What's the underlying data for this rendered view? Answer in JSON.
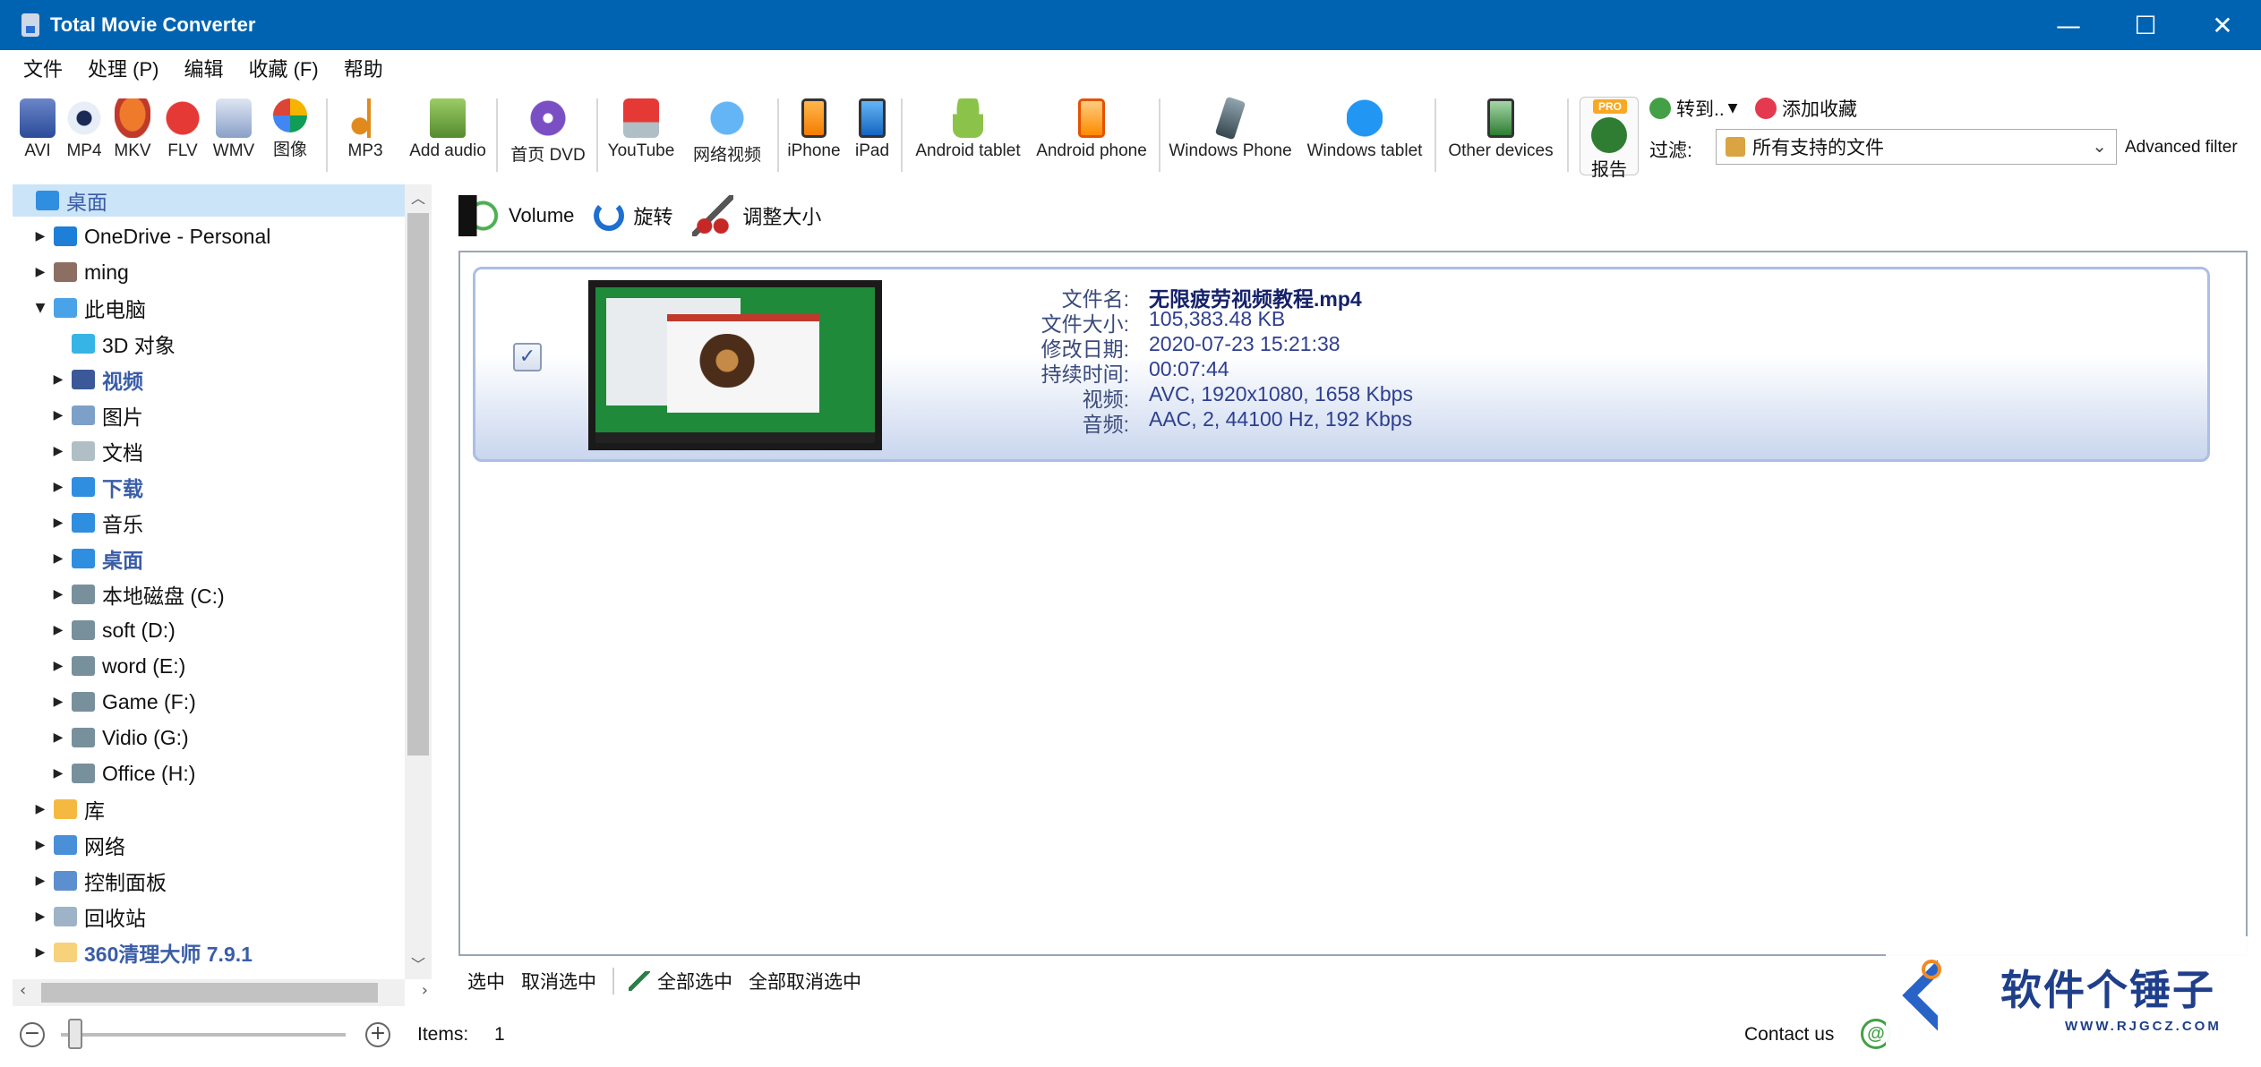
{
  "window": {
    "title": "Total Movie Converter"
  },
  "menu": [
    "文件",
    "处理 (P)",
    "编辑",
    "收藏 (F)",
    "帮助"
  ],
  "toolbar": {
    "formats": [
      "AVI",
      "MP4",
      "MKV",
      "FLV",
      "WMV",
      "图像"
    ],
    "audio": [
      "MP3",
      "Add audio"
    ],
    "disc": "首页 DVD",
    "web": [
      "YouTube",
      "网络视频"
    ],
    "apple": [
      "iPhone",
      "iPad"
    ],
    "android": [
      "Android tablet",
      "Android phone"
    ],
    "windows": [
      "Windows Phone",
      "Windows tablet"
    ],
    "other": "Other devices",
    "report": {
      "badge": "PRO",
      "label": "报告"
    },
    "goto": "转到..",
    "add_favorite": "添加收藏",
    "filter_label": "过滤:",
    "filter_value": "所有支持的文件",
    "advanced_filter": "Advanced filter"
  },
  "tree": [
    {
      "label": "桌面",
      "level": 0,
      "style": "selected-blue",
      "icon": "desktop-icon",
      "arrow": ""
    },
    {
      "label": "OneDrive - Personal",
      "level": 1,
      "icon": "cloud-icon",
      "arrow": "right"
    },
    {
      "label": "ming",
      "level": 1,
      "icon": "user-icon",
      "arrow": "right"
    },
    {
      "label": "此电脑",
      "level": 1,
      "icon": "computer-icon",
      "arrow": "down"
    },
    {
      "label": "3D 对象",
      "level": 2,
      "icon": "cube-icon",
      "arrow": ""
    },
    {
      "label": "视频",
      "level": 2,
      "style": "bold-blue",
      "icon": "video-folder-icon",
      "arrow": "right"
    },
    {
      "label": "图片",
      "level": 2,
      "icon": "picture-folder-icon",
      "arrow": "right"
    },
    {
      "label": "文档",
      "level": 2,
      "icon": "document-folder-icon",
      "arrow": "right"
    },
    {
      "label": "下载",
      "level": 2,
      "style": "bold-blue",
      "icon": "download-icon",
      "arrow": "right"
    },
    {
      "label": "音乐",
      "level": 2,
      "icon": "music-icon",
      "arrow": "right"
    },
    {
      "label": "桌面",
      "level": 2,
      "style": "bold-blue",
      "icon": "desktop-icon",
      "arrow": "right"
    },
    {
      "label": "本地磁盘 (C:)",
      "level": 2,
      "icon": "drive-icon",
      "arrow": "right"
    },
    {
      "label": "soft (D:)",
      "level": 2,
      "icon": "drive-icon",
      "arrow": "right"
    },
    {
      "label": "word (E:)",
      "level": 2,
      "icon": "drive-icon",
      "arrow": "right"
    },
    {
      "label": "Game (F:)",
      "level": 2,
      "icon": "drive-icon",
      "arrow": "right"
    },
    {
      "label": "Vidio (G:)",
      "level": 2,
      "icon": "drive-icon",
      "arrow": "right"
    },
    {
      "label": "Office (H:)",
      "level": 2,
      "icon": "drive-icon",
      "arrow": "right"
    },
    {
      "label": "库",
      "level": 1,
      "icon": "library-icon",
      "arrow": "right"
    },
    {
      "label": "网络",
      "level": 1,
      "icon": "network-icon",
      "arrow": "right"
    },
    {
      "label": "控制面板",
      "level": 1,
      "icon": "control-panel-icon",
      "arrow": "right"
    },
    {
      "label": "回收站",
      "level": 1,
      "icon": "recycle-bin-icon",
      "arrow": "right"
    },
    {
      "label": "360清理大师 7.9.1",
      "level": 1,
      "style": "bold-blue",
      "icon": "folder-icon",
      "arrow": "right"
    }
  ],
  "actions": [
    "Volume",
    "旋转",
    "调整大小"
  ],
  "file": {
    "keys": [
      "文件名:",
      "文件大小:",
      "修改日期:",
      "持续时间:",
      "视频:",
      "音频:"
    ],
    "values": [
      "无限疲劳视频教程.mp4",
      "105,383.48 KB",
      "2020-07-23 15:21:38",
      "00:07:44",
      "AVC, 1920x1080, 1658 Kbps",
      "AAC, 2, 44100 Hz, 192 Kbps"
    ],
    "checked_mark": "✓"
  },
  "selection": [
    "选中",
    "取消选中",
    "全部选中",
    "全部取消选中"
  ],
  "status": {
    "items_label": "Items:",
    "items_count": "1",
    "contact": "Contact us",
    "contact_icon": "@"
  },
  "watermark": {
    "text": "软件个锤子",
    "url": "WWW.RJGCZ.COM"
  },
  "colors": {
    "titlebar": "#0063b1",
    "accent_blue": "#3a5da8",
    "card_border": "#aabfe4"
  }
}
